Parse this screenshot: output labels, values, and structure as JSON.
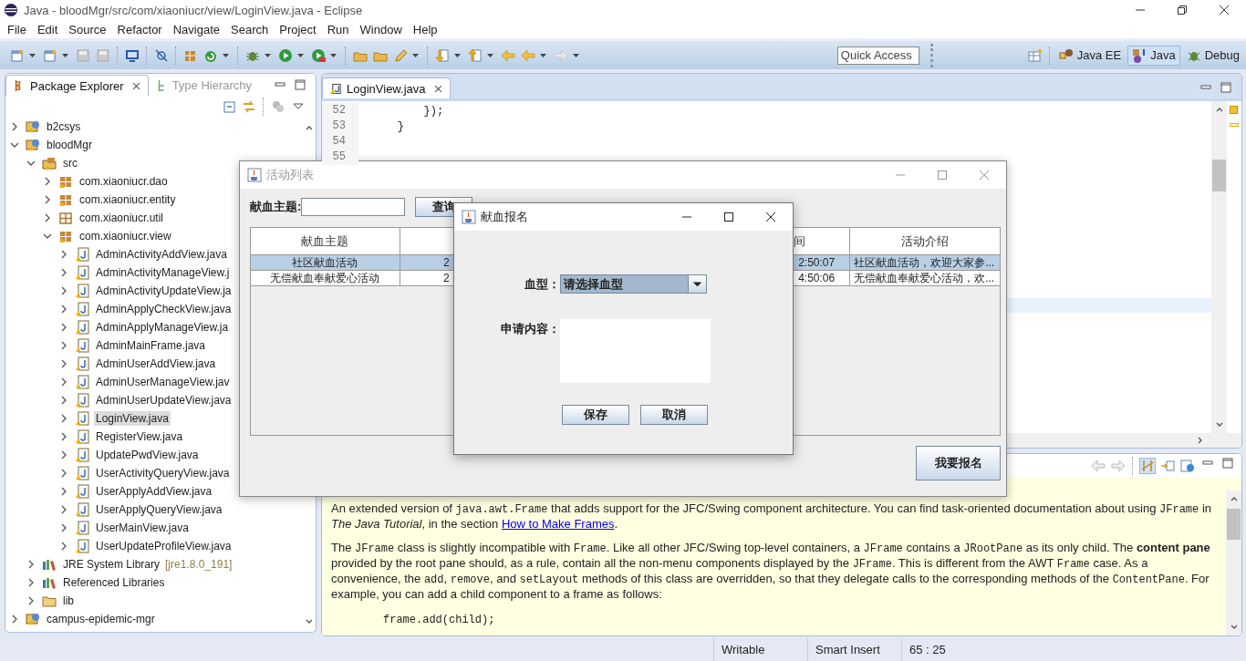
{
  "window": {
    "title": "Java - bloodMgr/src/com/xiaoniucr/view/LoginView.java - Eclipse"
  },
  "menu": [
    "File",
    "Edit",
    "Source",
    "Refactor",
    "Navigate",
    "Search",
    "Project",
    "Run",
    "Window",
    "Help"
  ],
  "quick_access": {
    "placeholder": "Quick Access"
  },
  "perspectives": [
    {
      "label": "Java EE",
      "selected": false
    },
    {
      "label": "Java",
      "selected": true
    },
    {
      "label": "Debug",
      "selected": false
    }
  ],
  "explorer": {
    "tabs": [
      {
        "label": "Package Explorer",
        "selected": true
      },
      {
        "label": "Type Hierarchy",
        "selected": false
      }
    ],
    "tree": [
      {
        "label": "b2csys",
        "kind": "project",
        "expanded": false,
        "selected": false
      },
      {
        "label": "bloodMgr",
        "kind": "project",
        "expanded": true,
        "selected": false,
        "children": [
          {
            "label": "src",
            "kind": "source-folder",
            "expanded": true,
            "selected": false,
            "children": [
              {
                "label": "com.xiaoniucr.dao",
                "kind": "package",
                "expanded": false,
                "selected": false
              },
              {
                "label": "com.xiaoniucr.entity",
                "kind": "package",
                "expanded": false,
                "selected": false
              },
              {
                "label": "com.xiaoniucr.util",
                "kind": "empty-package",
                "expanded": false,
                "selected": false
              },
              {
                "label": "com.xiaoniucr.view",
                "kind": "package",
                "expanded": true,
                "selected": false,
                "children": [
                  {
                    "label": "AdminActivityAddView.java",
                    "kind": "java-file",
                    "expanded": false,
                    "selected": false
                  },
                  {
                    "label": "AdminActivityManageView.j",
                    "kind": "java-file",
                    "expanded": false,
                    "selected": false
                  },
                  {
                    "label": "AdminActivityUpdateView.ja",
                    "kind": "java-file",
                    "expanded": false,
                    "selected": false
                  },
                  {
                    "label": "AdminApplyCheckView.java",
                    "kind": "java-file",
                    "expanded": false,
                    "selected": false
                  },
                  {
                    "label": "AdminApplyManageView.ja",
                    "kind": "java-file",
                    "expanded": false,
                    "selected": false
                  },
                  {
                    "label": "AdminMainFrame.java",
                    "kind": "java-file",
                    "expanded": false,
                    "selected": false
                  },
                  {
                    "label": "AdminUserAddView.java",
                    "kind": "java-file",
                    "expanded": false,
                    "selected": false
                  },
                  {
                    "label": "AdminUserManageView.jav",
                    "kind": "java-file",
                    "expanded": false,
                    "selected": false
                  },
                  {
                    "label": "AdminUserUpdateView.java",
                    "kind": "java-file",
                    "expanded": false,
                    "selected": false
                  },
                  {
                    "label": "LoginView.java",
                    "kind": "java-file",
                    "expanded": false,
                    "selected": true
                  },
                  {
                    "label": "RegisterView.java",
                    "kind": "java-file",
                    "expanded": false,
                    "selected": false
                  },
                  {
                    "label": "UpdatePwdView.java",
                    "kind": "java-file",
                    "expanded": false,
                    "selected": false
                  },
                  {
                    "label": "UserActivityQueryView.java",
                    "kind": "java-file",
                    "expanded": false,
                    "selected": false
                  },
                  {
                    "label": "UserApplyAddView.java",
                    "kind": "java-file",
                    "expanded": false,
                    "selected": false
                  },
                  {
                    "label": "UserApplyQueryView.java",
                    "kind": "java-file",
                    "expanded": false,
                    "selected": false
                  },
                  {
                    "label": "UserMainView.java",
                    "kind": "java-file",
                    "expanded": false,
                    "selected": false
                  },
                  {
                    "label": "UserUpdateProfileView.java",
                    "kind": "java-file",
                    "expanded": false,
                    "selected": false
                  }
                ]
              }
            ]
          },
          {
            "label": "JRE System Library",
            "decoration": "[jre1.8.0_191]",
            "kind": "library",
            "expanded": false,
            "selected": false
          },
          {
            "label": "Referenced Libraries",
            "kind": "library",
            "expanded": false,
            "selected": false
          },
          {
            "label": "lib",
            "kind": "folder",
            "expanded": false,
            "selected": false
          }
        ]
      },
      {
        "label": "campus-epidemic-mgr",
        "kind": "project",
        "expanded": false,
        "selected": false
      }
    ]
  },
  "editor": {
    "tabs": [
      {
        "label": "LoginView.java",
        "selected": true
      }
    ],
    "lines": [
      {
        "number": "52",
        "code": "        });"
      },
      {
        "number": "53",
        "code": "    }"
      },
      {
        "number": "54"
      },
      {
        "number": "55"
      }
    ]
  },
  "javadoc": {
    "paragraphs": [
      [
        {
          "kind": "text",
          "text": "An extended version of "
        },
        {
          "kind": "code",
          "text": "java.awt.Frame"
        },
        {
          "kind": "text",
          "text": " that adds support for the JFC/Swing component architecture. You can find task-oriented documentation about using "
        },
        {
          "kind": "code",
          "text": "JFrame"
        },
        {
          "kind": "text",
          "text": " in "
        },
        {
          "kind": "italic",
          "text": "The Java Tutorial"
        },
        {
          "kind": "text",
          "text": ", in the section "
        },
        {
          "kind": "link",
          "text": "How to Make Frames"
        },
        {
          "kind": "text",
          "text": "."
        }
      ],
      [
        {
          "kind": "text",
          "text": "The "
        },
        {
          "kind": "code",
          "text": "JFrame"
        },
        {
          "kind": "text",
          "text": " class is slightly incompatible with "
        },
        {
          "kind": "code",
          "text": "Frame"
        },
        {
          "kind": "text",
          "text": ". Like all other JFC/Swing top-level containers, a "
        },
        {
          "kind": "code",
          "text": "JFrame"
        },
        {
          "kind": "text",
          "text": " contains a "
        },
        {
          "kind": "code",
          "text": "JRootPane"
        },
        {
          "kind": "text",
          "text": " as its only child. The "
        },
        {
          "kind": "bold",
          "text": "content pane"
        },
        {
          "kind": "text",
          "text": " provided by the root pane should, as a rule, contain all the non-menu components displayed by the "
        },
        {
          "kind": "code",
          "text": "JFrame"
        },
        {
          "kind": "text",
          "text": ". This is different from the AWT "
        },
        {
          "kind": "code",
          "text": "Frame"
        },
        {
          "kind": "text",
          "text": " case. As a convenience, the "
        },
        {
          "kind": "code",
          "text": "add"
        },
        {
          "kind": "text",
          "text": ", "
        },
        {
          "kind": "code",
          "text": "remove"
        },
        {
          "kind": "text",
          "text": ", and "
        },
        {
          "kind": "code",
          "text": "setLayout"
        },
        {
          "kind": "text",
          "text": " methods of this class are overridden, so that they delegate calls to the corresponding methods of the "
        },
        {
          "kind": "code",
          "text": "ContentPane"
        },
        {
          "kind": "text",
          "text": ". For example, you can add a child component to a frame as follows:"
        }
      ]
    ],
    "code_sample": "frame.add(child);"
  },
  "status_bar": [
    "Writable",
    "Smart Insert",
    "65 : 25"
  ],
  "activity_window": {
    "title": "活动列表",
    "search_label": "献血主题:",
    "query_button": "查询",
    "table": {
      "columns": [
        {
          "label": "献血主题"
        },
        {},
        {
          "label": "间"
        },
        {
          "label": "活动介绍"
        }
      ],
      "rows": [
        {
          "selected": true,
          "cells": [
            "社区献血活动",
            "2",
            "2:50:07",
            "社区献血活动，欢迎大家参..."
          ]
        },
        {
          "selected": false,
          "cells": [
            "无偿献血奉献爱心活动",
            "2",
            "4:50:06",
            "无偿献血奉献爱心活动，欢..."
          ]
        }
      ]
    },
    "signup_button": "我要报名"
  },
  "dialog": {
    "title": "献血报名",
    "blood_type": {
      "label": "血型：",
      "value": "请选择血型"
    },
    "content": {
      "label": "申请内容："
    },
    "buttons": [
      "保存",
      "取消"
    ]
  }
}
